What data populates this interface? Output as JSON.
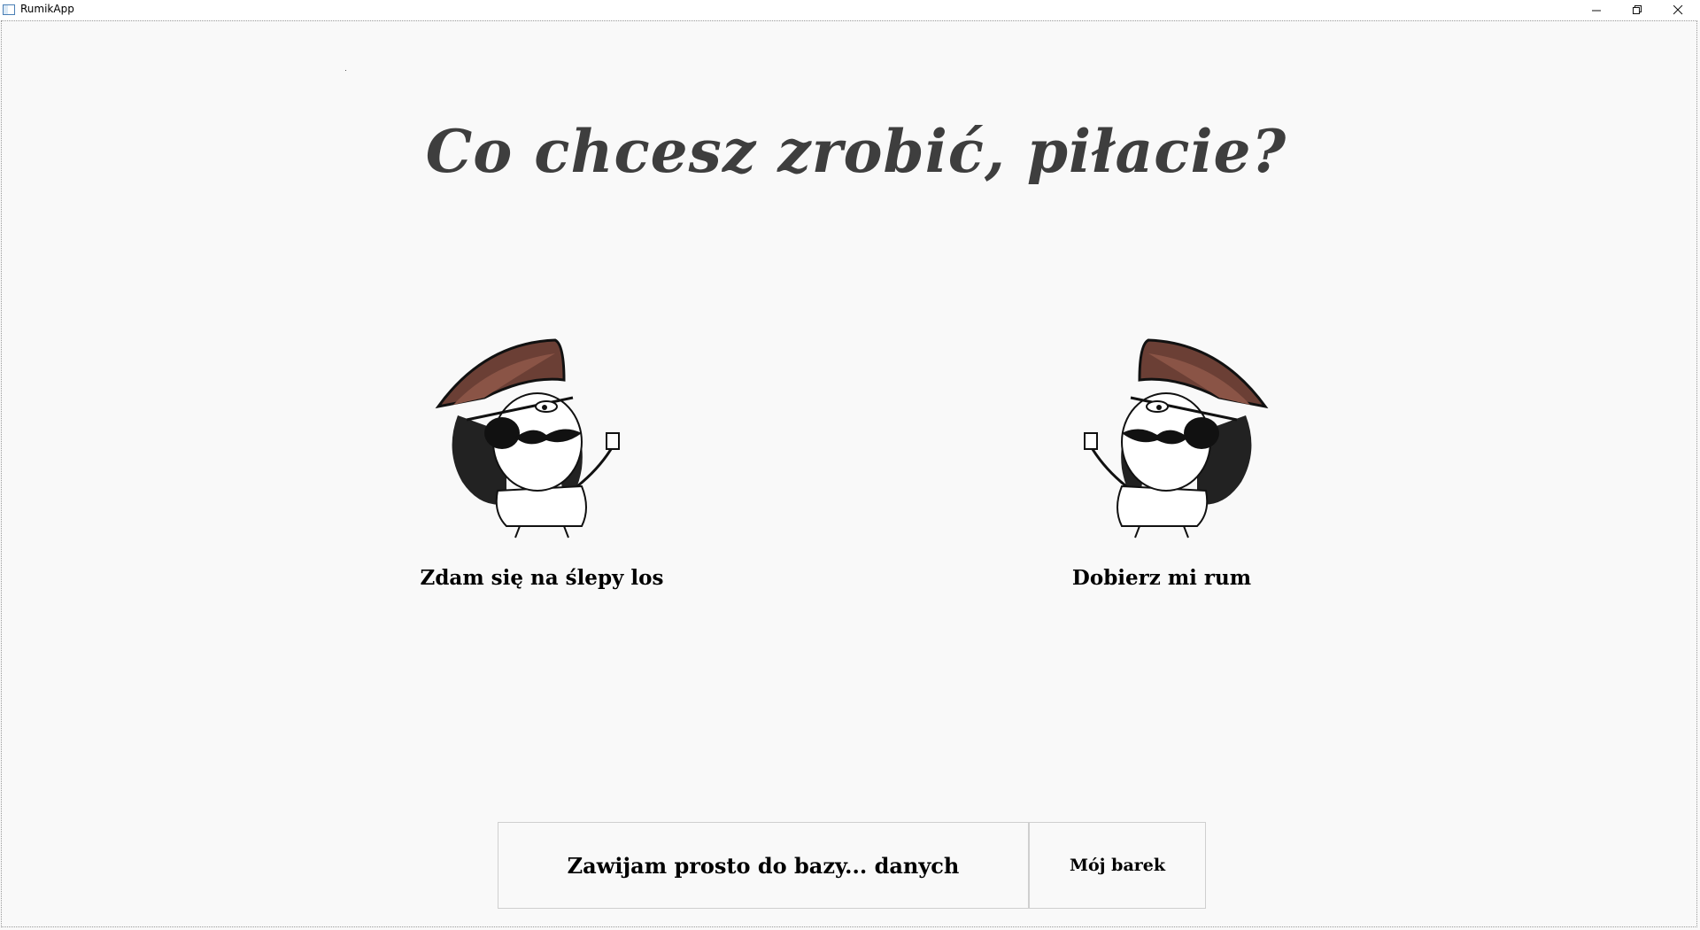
{
  "window": {
    "title": "RumikApp"
  },
  "main": {
    "heading": "Co chcesz zrobić, piłacie?",
    "options": [
      {
        "label": "Zdam się na ślepy los",
        "icon": "pirate-icon"
      },
      {
        "label": "Dobierz mi rum",
        "icon": "pirate-icon"
      }
    ]
  },
  "footer": {
    "database_button": "Zawijam prosto do bazy... danych",
    "bar_button": "Mój barek"
  },
  "colors": {
    "heading": "#3e3e3e",
    "hat": "#6b3f35",
    "background": "#f9f9f9"
  }
}
